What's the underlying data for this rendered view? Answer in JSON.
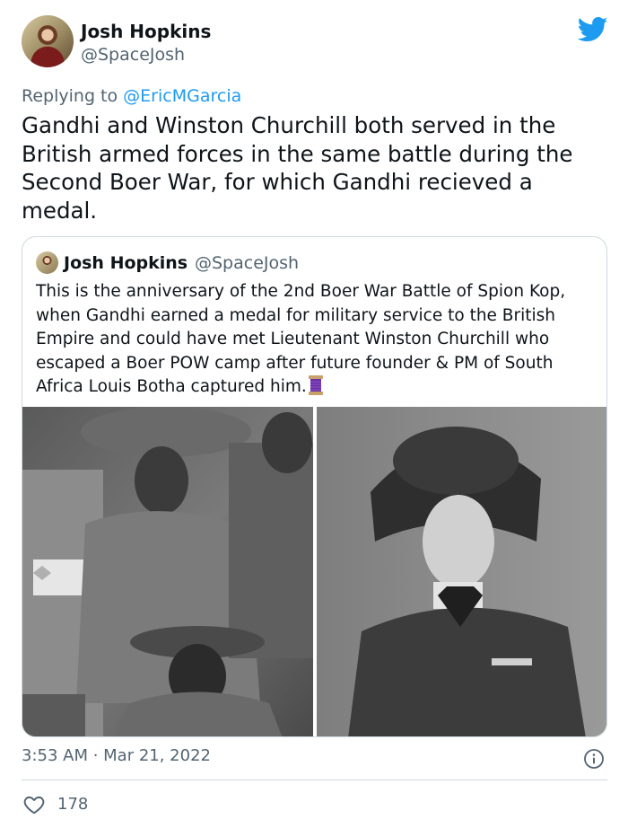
{
  "tweet": {
    "author_name": "Josh Hopkins",
    "author_handle": "@SpaceJosh",
    "replying_label": "Replying to",
    "replying_to": "@EricMGarcia",
    "text": "Gandhi and Winston Churchill both served in the British armed forces in the same battle during the Second Boer War, for which Gandhi recieved a medal.",
    "timestamp": "3:53 AM · Mar 21, 2022",
    "likes": "178"
  },
  "quoted": {
    "author_name": "Josh Hopkins",
    "author_handle": "@SpaceJosh",
    "text": "This is the anniversary of the 2nd Boer War Battle of Spion Kop, when Gandhi earned a medal for military service to the British Empire and could have met Lieutenant Winston Churchill who escaped a Boer POW camp after future founder & PM of South Africa Louis Botha captured him.",
    "emoji": "spool-of-thread-icon"
  },
  "icons": {
    "brand": "twitter-bird-icon",
    "info": "info-icon",
    "like": "heart-icon"
  },
  "colors": {
    "brand": "#1d9bf0",
    "secondary_text": "#536471",
    "primary_text": "#0f1419",
    "border": "#cfd9de"
  }
}
